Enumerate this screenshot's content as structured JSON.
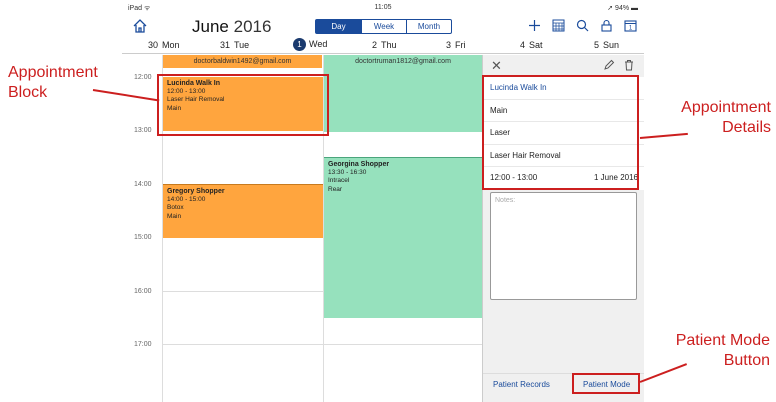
{
  "status": {
    "device": "iPad ᯤ",
    "time": "11:05",
    "battery": "➚ 94% ▬"
  },
  "toolbar": {
    "month": "June",
    "year": "2016",
    "views": [
      "Day",
      "Week",
      "Month"
    ],
    "active_view": "Day"
  },
  "days": [
    {
      "num": "30",
      "name": "Mon"
    },
    {
      "num": "31",
      "name": "Tue"
    },
    {
      "num": "1",
      "name": "Wed",
      "today": true
    },
    {
      "num": "2",
      "name": "Thu"
    },
    {
      "num": "3",
      "name": "Fri"
    },
    {
      "num": "4",
      "name": "Sat"
    },
    {
      "num": "5",
      "name": "Sun"
    }
  ],
  "hours": [
    "12:00",
    "13:00",
    "14:00",
    "15:00",
    "16:00",
    "17:00"
  ],
  "columns": [
    "doctorbaldwin1492@gmail.com",
    "doctortruman1812@gmail.com"
  ],
  "appointments": [
    {
      "name": "Lucinda Walk In",
      "time": "12:00 - 13:00",
      "treatment": "Laser Hair Removal",
      "location": "Main"
    },
    {
      "name": "Gregory Shopper",
      "time": "14:00 - 15:00",
      "treatment": "Botox",
      "location": "Main"
    },
    {
      "name": "Georgina Shopper",
      "time": "13:30 - 16:30",
      "treatment": "Intracel",
      "location": "Rear"
    }
  ],
  "details": {
    "name": "Lucinda Walk In",
    "location": "Main",
    "category": "Laser",
    "treatment": "Laser Hair Removal",
    "time": "12:00 - 13:00",
    "date": "1 June 2016",
    "notes_placeholder": "Notes:"
  },
  "bottom": {
    "records": "Patient Records",
    "patient_mode": "Patient Mode"
  },
  "annotations": {
    "block": "Appointment Block",
    "details": "Appointment Details",
    "patient_mode": "Patient Mode Button"
  },
  "colors": {
    "accent": "#1a4b9b",
    "appointment_orange": "#ffa53e",
    "appointment_green": "#96e1bd",
    "annotation_red": "#cc1f1f"
  }
}
